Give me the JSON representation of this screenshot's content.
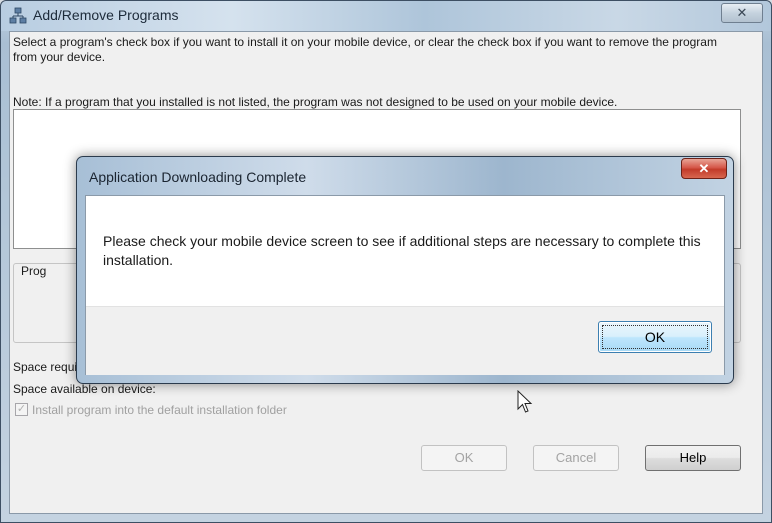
{
  "window": {
    "title": "Add/Remove Programs",
    "close_glyph": "✕",
    "icon": "network-programs-icon"
  },
  "main": {
    "instructions": "Select a program's check box if you want to install it on your mobile device, or clear the check box if you want to remove the program from your device.",
    "note": "Note:  If a program that you installed is not listed, the program was not designed to be used on your mobile device.",
    "group_label": "Prog",
    "space_required_label": "Space required for selected programs:",
    "space_available_label": "Space available on device:",
    "install_default_folder": {
      "label": "Install program into the default installation folder",
      "checked": true,
      "disabled": true
    }
  },
  "buttons": {
    "ok": "OK",
    "cancel": "Cancel",
    "help": "Help"
  },
  "dialog": {
    "title": "Application Downloading Complete",
    "close_glyph": "✕",
    "message": "Please check your mobile device screen to see if additional steps are necessary to complete this installation.",
    "ok_label": "OK"
  },
  "colors": {
    "accent_close": "#c23b2a",
    "default_button": "#3c7fb1",
    "client_bg": "#f0f0f0"
  }
}
